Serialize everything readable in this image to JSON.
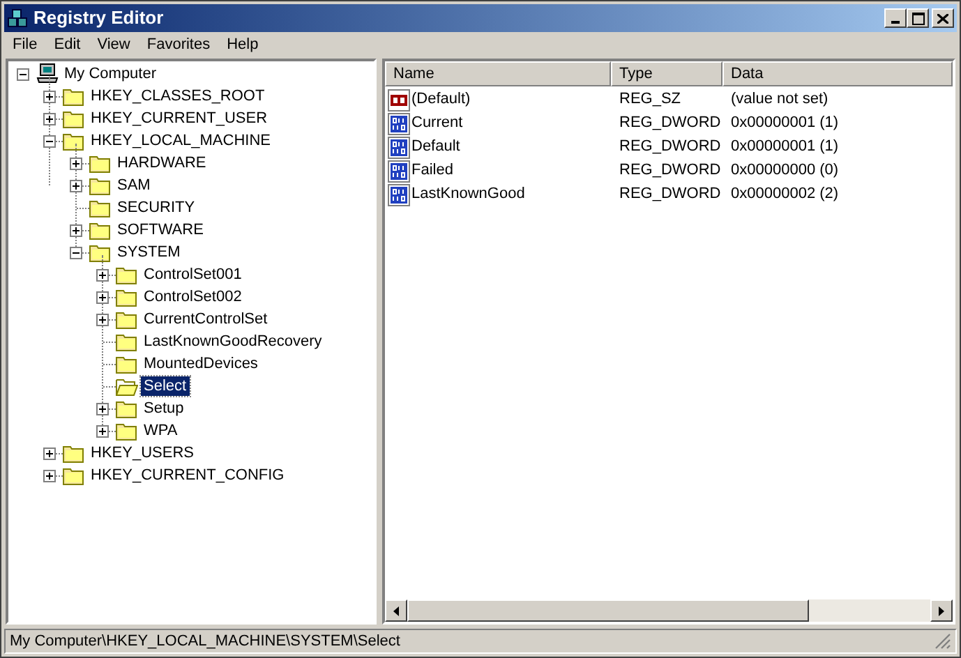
{
  "window": {
    "title": "Registry Editor"
  },
  "menu": [
    {
      "label": "File"
    },
    {
      "label": "Edit"
    },
    {
      "label": "View"
    },
    {
      "label": "Favorites"
    },
    {
      "label": "Help"
    }
  ],
  "tree": [
    {
      "label": "My Computer",
      "kind": "computer",
      "expanded": true,
      "selected": false,
      "children": [
        {
          "label": "HKEY_CLASSES_ROOT",
          "kind": "folder",
          "expanded": false,
          "selected": false
        },
        {
          "label": "HKEY_CURRENT_USER",
          "kind": "folder",
          "expanded": false,
          "selected": false
        },
        {
          "label": "HKEY_LOCAL_MACHINE",
          "kind": "folder",
          "expanded": true,
          "selected": false,
          "children": [
            {
              "label": "HARDWARE",
              "kind": "folder",
              "expanded": false,
              "selected": false
            },
            {
              "label": "SAM",
              "kind": "folder",
              "expanded": false,
              "selected": false
            },
            {
              "label": "SECURITY",
              "kind": "folder",
              "selected": false
            },
            {
              "label": "SOFTWARE",
              "kind": "folder",
              "expanded": false,
              "selected": false
            },
            {
              "label": "SYSTEM",
              "kind": "folder",
              "expanded": true,
              "selected": false,
              "children": [
                {
                  "label": "ControlSet001",
                  "kind": "folder",
                  "expanded": false,
                  "selected": false
                },
                {
                  "label": "ControlSet002",
                  "kind": "folder",
                  "expanded": false,
                  "selected": false
                },
                {
                  "label": "CurrentControlSet",
                  "kind": "folder",
                  "expanded": false,
                  "selected": false
                },
                {
                  "label": "LastKnownGoodRecovery",
                  "kind": "folder",
                  "selected": false
                },
                {
                  "label": "MountedDevices",
                  "kind": "folder",
                  "selected": false
                },
                {
                  "label": "Select",
                  "kind": "folder",
                  "selected": true
                },
                {
                  "label": "Setup",
                  "kind": "folder",
                  "expanded": false,
                  "selected": false
                },
                {
                  "label": "WPA",
                  "kind": "folder",
                  "expanded": false,
                  "selected": false
                }
              ]
            }
          ]
        },
        {
          "label": "HKEY_USERS",
          "kind": "folder",
          "expanded": false,
          "selected": false
        },
        {
          "label": "HKEY_CURRENT_CONFIG",
          "kind": "folder",
          "expanded": false,
          "selected": false
        }
      ]
    }
  ],
  "table": {
    "columns": [
      "Name",
      "Type",
      "Data"
    ],
    "rows": [
      {
        "kind": "string",
        "name": "(Default)",
        "type": "REG_SZ",
        "data": "(value not set)"
      },
      {
        "kind": "dword",
        "name": "Current",
        "type": "REG_DWORD",
        "data": "0x00000001 (1)"
      },
      {
        "kind": "dword",
        "name": "Default",
        "type": "REG_DWORD",
        "data": "0x00000001 (1)"
      },
      {
        "kind": "dword",
        "name": "Failed",
        "type": "REG_DWORD",
        "data": "0x00000000 (0)"
      },
      {
        "kind": "dword",
        "name": "LastKnownGood",
        "type": "REG_DWORD",
        "data": "0x00000002 (2)"
      }
    ]
  },
  "status_bar": "My Computer\\HKEY_LOCAL_MACHINE\\SYSTEM\\Select"
}
